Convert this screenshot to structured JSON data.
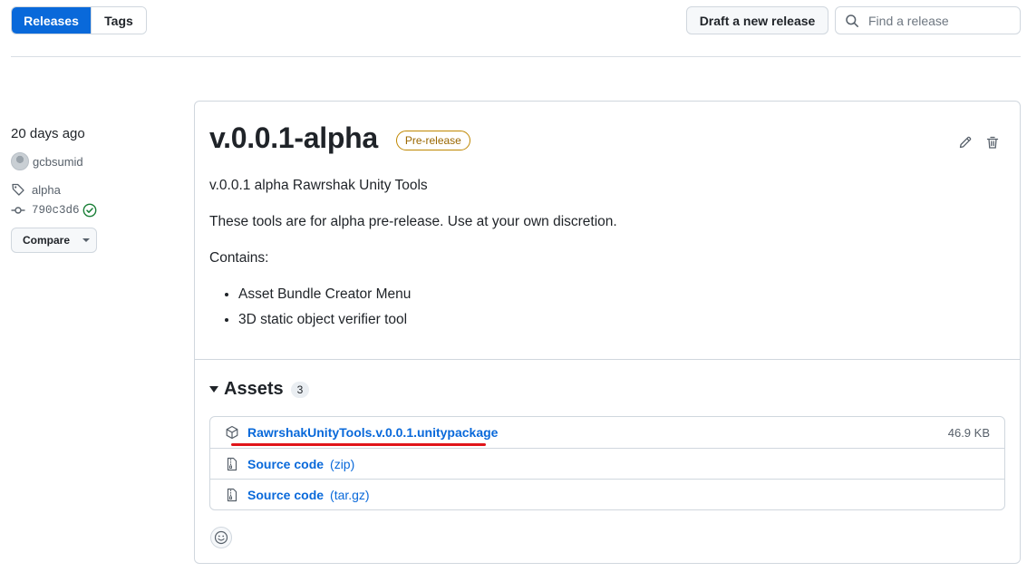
{
  "nav": {
    "releases_label": "Releases",
    "tags_label": "Tags"
  },
  "toolbar": {
    "draft_label": "Draft a new release",
    "search_placeholder": "Find a release"
  },
  "meta": {
    "date": "20 days ago",
    "author": "gcbsumid",
    "tag": "alpha",
    "commit": "790c3d6",
    "compare_label": "Compare"
  },
  "release": {
    "title": "v.0.0.1-alpha",
    "badge": "Pre-release",
    "p1": "v.0.0.1 alpha Rawrshak Unity Tools",
    "p2": "These tools are for alpha pre-release. Use at your own discretion.",
    "p3": "Contains:",
    "items": [
      "Asset Bundle Creator Menu",
      "3D static object verifier tool"
    ]
  },
  "assets": {
    "heading": "Assets",
    "count": "3",
    "files": [
      {
        "name": "RawrshakUnityTools.v.0.0.1.unitypackage",
        "size": "46.9 KB"
      },
      {
        "name": "Source code",
        "suffix": "(zip)"
      },
      {
        "name": "Source code",
        "suffix": "(tar.gz)"
      }
    ]
  },
  "colors": {
    "accent": "#0969da",
    "prerelease": "#9a6700",
    "annotation": "#e0151a",
    "verified": "#1a7f37"
  }
}
